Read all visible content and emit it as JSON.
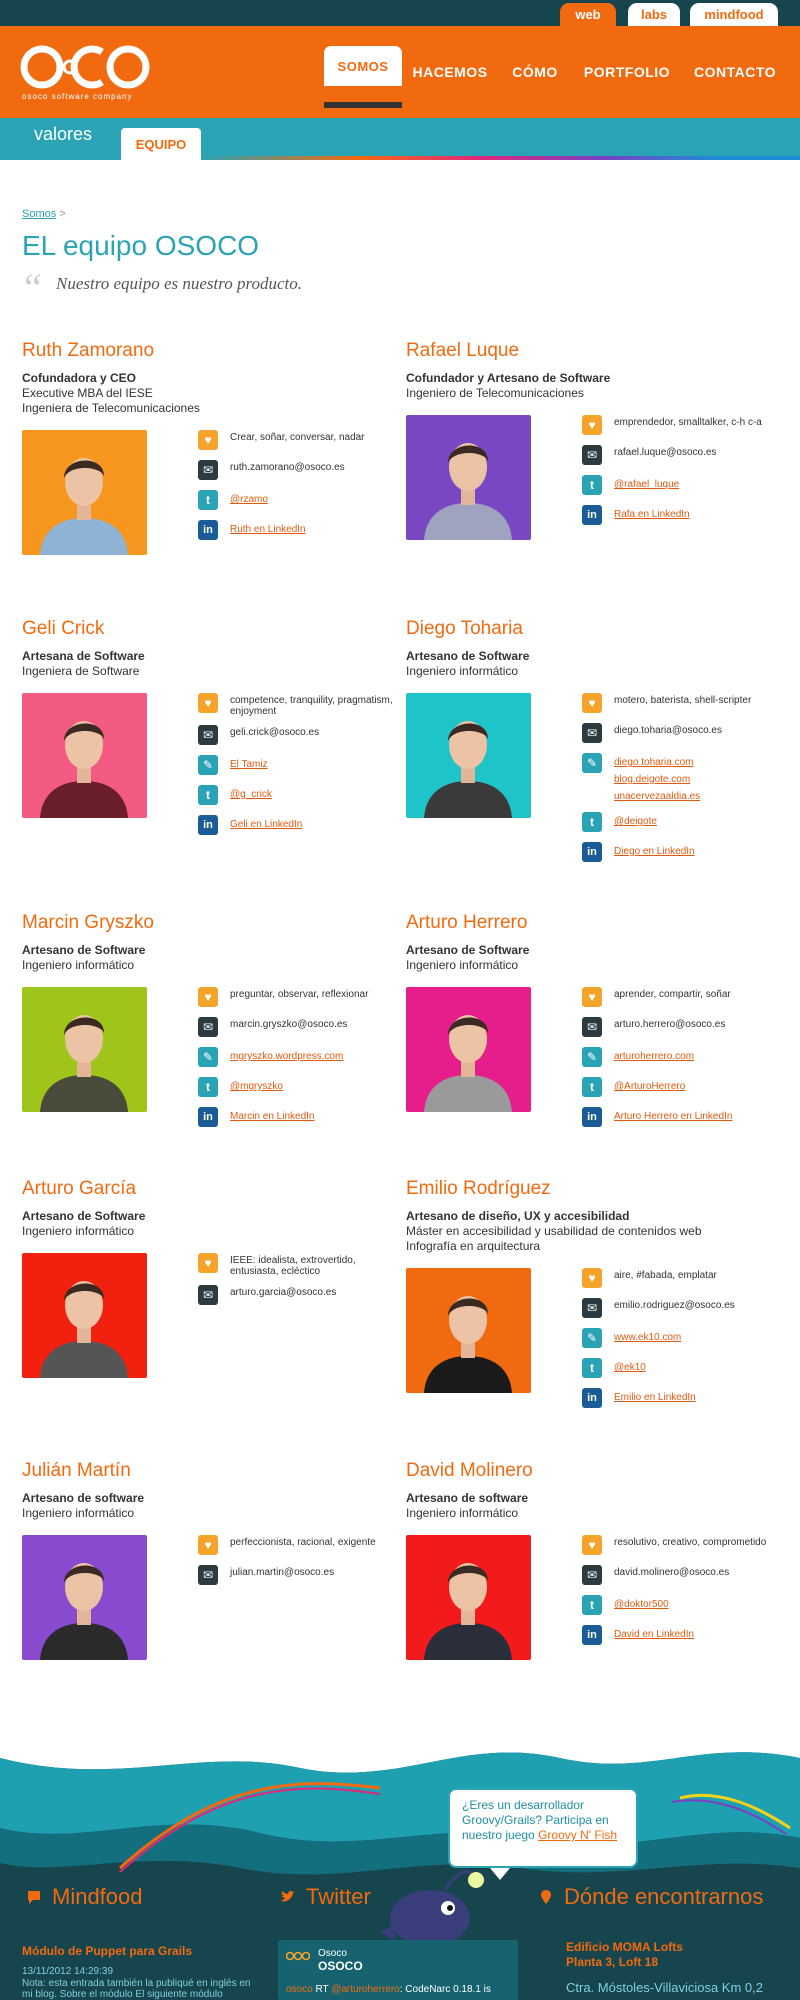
{
  "top_tabs": [
    "web",
    "labs",
    "mindfood"
  ],
  "logo": {
    "text": "OCO",
    "subtitle": "osoco software company"
  },
  "nav": [
    "SOMOS",
    "HACEMOS",
    "CÓMO",
    "PORTFOLIO",
    "CONTACTO"
  ],
  "subnav": {
    "valores": "valores",
    "equipo": "EQUIPO"
  },
  "breadcrumb": {
    "link": "Somos",
    "sep": ">"
  },
  "title": "EL equipo OSOCO",
  "subtitle": "Nuestro equipo es nuestro producto.",
  "members": [
    {
      "name": "Ruth Zamorano",
      "role": "Cofundadora y CEO",
      "lines": [
        "Executive MBA del IESE",
        "Ingeniera de Telecomunicaciones"
      ],
      "photo_bg": "#f7961e",
      "shirt": "#8fb3d4",
      "info": [
        {
          "icon": "heart",
          "text": "Crear, soñar, conversar, nadar"
        },
        {
          "icon": "mail",
          "text": "ruth.zamorano@osoco.es"
        },
        {
          "icon": "tw",
          "link": "@rzamo"
        },
        {
          "icon": "li",
          "link": "Ruth en LinkedIn"
        }
      ]
    },
    {
      "name": "Rafael Luque",
      "role": "Cofundador y Artesano de Software",
      "lines": [
        "Ingeniero de Telecomunicaciones"
      ],
      "photo_bg": "#7a48c2",
      "shirt": "#9fa3c0",
      "info": [
        {
          "icon": "heart",
          "text": "emprendedor, smalltalker, c-h c-a"
        },
        {
          "icon": "mail",
          "text": "rafael.luque@osoco.es"
        },
        {
          "icon": "tw",
          "link": "@rafael_luque"
        },
        {
          "icon": "li",
          "link": "Rafa en LinkedIn"
        }
      ]
    },
    {
      "name": "Geli Crick",
      "role": "Artesana de Software",
      "lines": [
        "Ingeniera de Software"
      ],
      "photo_bg": "#f25a82",
      "shirt": "#6a1e2c",
      "info": [
        {
          "icon": "heart",
          "text": "competence, tranquility, pragmatism, enjoyment"
        },
        {
          "icon": "mail",
          "text": "geli.crick@osoco.es"
        },
        {
          "icon": "blog",
          "link": "El Tamiz"
        },
        {
          "icon": "tw",
          "link": "@g_crick"
        },
        {
          "icon": "li",
          "link": "Geli en LinkedIn"
        }
      ]
    },
    {
      "name": "Diego Toharia",
      "role": "Artesano de Software",
      "lines": [
        "Ingeniero informático"
      ],
      "photo_bg": "#1fc4c8",
      "shirt": "#3a3a3a",
      "info": [
        {
          "icon": "heart",
          "text": "motero, baterista, shell-scripter"
        },
        {
          "icon": "mail",
          "text": "diego.toharia@osoco.es"
        },
        {
          "icon": "blog",
          "links": [
            "diego.toharia.com",
            "blog.deigote.com",
            "unacervezaaldia.es"
          ]
        },
        {
          "icon": "tw",
          "link": "@deigote"
        },
        {
          "icon": "li",
          "link": "Diego en LinkedIn"
        }
      ]
    },
    {
      "name": "Marcin Gryszko",
      "role": "Artesano de Software",
      "lines": [
        "Ingeniero informático"
      ],
      "photo_bg": "#9fc41a",
      "shirt": "#4a4a3a",
      "info": [
        {
          "icon": "heart",
          "text": "preguntar, observar, reflexionar"
        },
        {
          "icon": "mail",
          "text": "marcin.gryszko@osoco.es"
        },
        {
          "icon": "blog",
          "link": "mgryszko.wordpress.com"
        },
        {
          "icon": "tw",
          "link": "@mgryszko"
        },
        {
          "icon": "li",
          "link": "Marcin en LinkedIn"
        }
      ]
    },
    {
      "name": "Arturo Herrero",
      "role": "Artesano de Software",
      "lines": [
        "Ingeniero informático"
      ],
      "photo_bg": "#e51e8c",
      "shirt": "#9a9a9a",
      "info": [
        {
          "icon": "heart",
          "text": "aprender, compartir, soñar"
        },
        {
          "icon": "mail",
          "text": "arturo.herrero@osoco.es"
        },
        {
          "icon": "blog",
          "link": "arturoherrero.com"
        },
        {
          "icon": "tw",
          "link": "@ArturoHerrero"
        },
        {
          "icon": "li",
          "link": "Arturo Herrero en LinkedIn"
        }
      ]
    },
    {
      "name": "Arturo García",
      "role": "Artesano de Software",
      "lines": [
        "Ingeniero informático"
      ],
      "photo_bg": "#f2200f",
      "shirt": "#555",
      "info": [
        {
          "icon": "heart",
          "text": "IEEE: idealista, extrovertido, entusiasta, ecléctico"
        },
        {
          "icon": "mail",
          "text": "arturo.garcia@osoco.es"
        }
      ]
    },
    {
      "name": "Emilio Rodríguez",
      "role": "Artesano de diseño, UX y accesibilidad",
      "lines": [
        "Máster en accesibilidad y usabilidad de contenidos web",
        "Infografía en arquitectura"
      ],
      "photo_bg": "#f26a10",
      "shirt": "#1a1a1a",
      "info": [
        {
          "icon": "heart",
          "text": "aire, #fabada, emplatar"
        },
        {
          "icon": "mail",
          "text": "emilio.rodriguez@osoco.es"
        },
        {
          "icon": "blog",
          "link": "www.ek10.com"
        },
        {
          "icon": "tw",
          "link": "@ek10"
        },
        {
          "icon": "li",
          "link": "Emilio en LinkedIn"
        }
      ]
    },
    {
      "name": "Julián Martín",
      "role": "Artesano de software",
      "lines": [
        "Ingeniero informático"
      ],
      "photo_bg": "#8a4ad0",
      "shirt": "#2a2a2a",
      "info": [
        {
          "icon": "heart",
          "text": "perfeccionista, racional, exigente"
        },
        {
          "icon": "mail",
          "text": "julian.martin@osoco.es"
        }
      ]
    },
    {
      "name": "David Molinero",
      "role": "Artesano de software",
      "lines": [
        "Ingeniero informático"
      ],
      "photo_bg": "#f21a1a",
      "shirt": "#2a2e3a",
      "info": [
        {
          "icon": "heart",
          "text": "resolutivo, creativo, comprometido"
        },
        {
          "icon": "mail",
          "text": "david.molinero@osoco.es"
        },
        {
          "icon": "tw",
          "link": "@doktor500"
        },
        {
          "icon": "li",
          "link": "David en LinkedIn"
        }
      ]
    }
  ],
  "footer": {
    "bubble_text": "¿Eres un desarrollador Groovy/Grails? Participa en nuestro juego ",
    "bubble_link": "Groovy N' Fish",
    "mindfood": "Mindfood",
    "twitter": "Twitter",
    "donde": "Dónde encontrarnos",
    "post_title": "Módulo de Puppet para Grails",
    "post_date": "13/11/2012 14:29:39",
    "post_text": "Nota: esta entrada también la publiqué en inglés en mi blog. Sobre el módulo El siguiente módulo",
    "tw_account": "Osoco",
    "tw_account_bold": "OSOCO",
    "tw_user": "osoco",
    "tw_rt": "RT",
    "tw_mention": "@arturoherrero",
    "tw_text": ": CodeNarc 0.18.1 is",
    "addr1": "Edificio MOMA Lofts",
    "addr2": "Planta 3, Loft 18",
    "addr3": "Ctra. Móstoles-Villaviciosa Km 0,2"
  }
}
